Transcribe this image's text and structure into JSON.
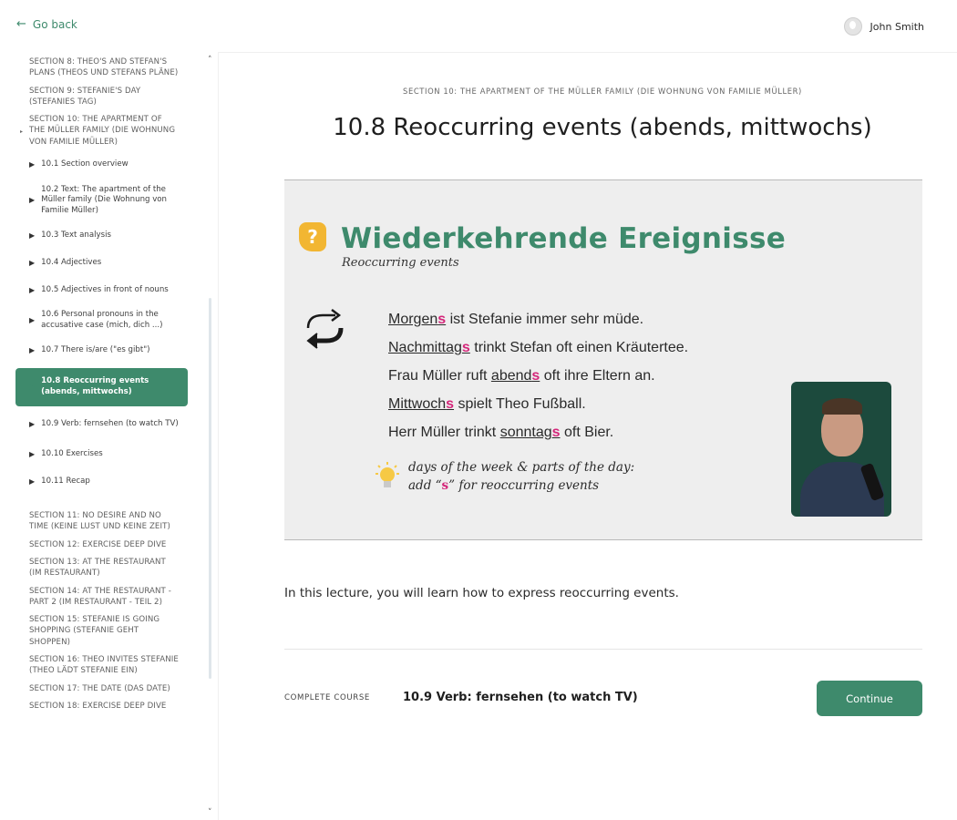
{
  "topbar": {
    "back_label": "Go back",
    "user_name": "John Smith"
  },
  "sidebar": {
    "sections_before": [
      "SECTION 8: THEO'S AND STEFAN'S PLANS (THEOS UND STEFANS PLÄNE)",
      "SECTION 9: STEFANIE'S DAY (STEFANIES TAG)",
      "SECTION 10: THE APARTMENT OF THE MÜLLER FAMILY (DIE WOHNUNG VON FAMILIE MÜLLER)"
    ],
    "lessons": [
      "10.1 Section overview",
      "10.2 Text: The apartment of the Müller family (Die Wohnung von Familie Müller)",
      "10.3 Text analysis",
      "10.4 Adjectives",
      "10.5 Adjectives in front of nouns",
      "10.6 Personal pronouns in the accusative case (mich, dich ...)",
      "10.7 There is/are (\"es gibt\")",
      "10.8 Reoccurring events (abends, mittwochs)",
      "10.9 Verb: fernsehen (to watch TV)",
      "10.10 Exercises",
      "10.11 Recap"
    ],
    "sections_after": [
      "SECTION 11: NO DESIRE AND NO TIME (KEINE LUST UND KEINE ZEIT)",
      "SECTION 12: EXERCISE DEEP DIVE",
      "SECTION 13: AT THE RESTAURANT (IM RESTAURANT)",
      "SECTION 14: AT THE RESTAURANT - PART 2 (IM RESTAURANT - TEIL 2)",
      "SECTION 15: STEFANIE IS GOING SHOPPING (STEFANIE GEHT SHOPPEN)",
      "SECTION 16: THEO INVITES STEFANIE (THEO LÄDT STEFANIE EIN)",
      "SECTION 17: THE DATE (DAS DATE)",
      "SECTION 18: EXERCISE DEEP DIVE"
    ]
  },
  "main": {
    "breadcrumb": "SECTION 10: THE APARTMENT OF THE MÜLLER FAMILY (DIE WOHNUNG VON FAMILIE MÜLLER)",
    "title": "10.8 Reoccurring events (abends, mittwochs)",
    "slide": {
      "title": "Wiederkehrende Ereignisse",
      "subtitle": "Reoccurring events",
      "s1_a": "Morgen",
      "s1_b": "s",
      "s1_c": " ist Stefanie immer sehr müde.",
      "s2_a": "Nachmittag",
      "s2_b": "s",
      "s2_c": " trinkt Stefan oft einen Kräutertee.",
      "s3_pre": "Frau Müller ruft ",
      "s3_a": "abend",
      "s3_b": "s",
      "s3_c": " oft ihre Eltern an.",
      "s4_a": "Mittwoch",
      "s4_b": "s",
      "s4_c": " spielt Theo Fußball.",
      "s5_pre": "Herr Müller trinkt ",
      "s5_a": "sonntag",
      "s5_b": "s",
      "s5_c": " oft Bier.",
      "tip_line1": "days of the week  & parts of the day:",
      "tip_l2_pre": "add “",
      "tip_l2_s": "s",
      "tip_l2_post": "” for reoccurring events"
    },
    "description": "In this lecture, you will learn how to express reoccurring events.",
    "complete_label": "COMPLETE COURSE",
    "next_lesson": "10.9 Verb: fernsehen (to watch TV)",
    "continue_label": "Continue"
  },
  "colors": {
    "accent": "#3e8a6c",
    "highlight": "#d4277a"
  }
}
